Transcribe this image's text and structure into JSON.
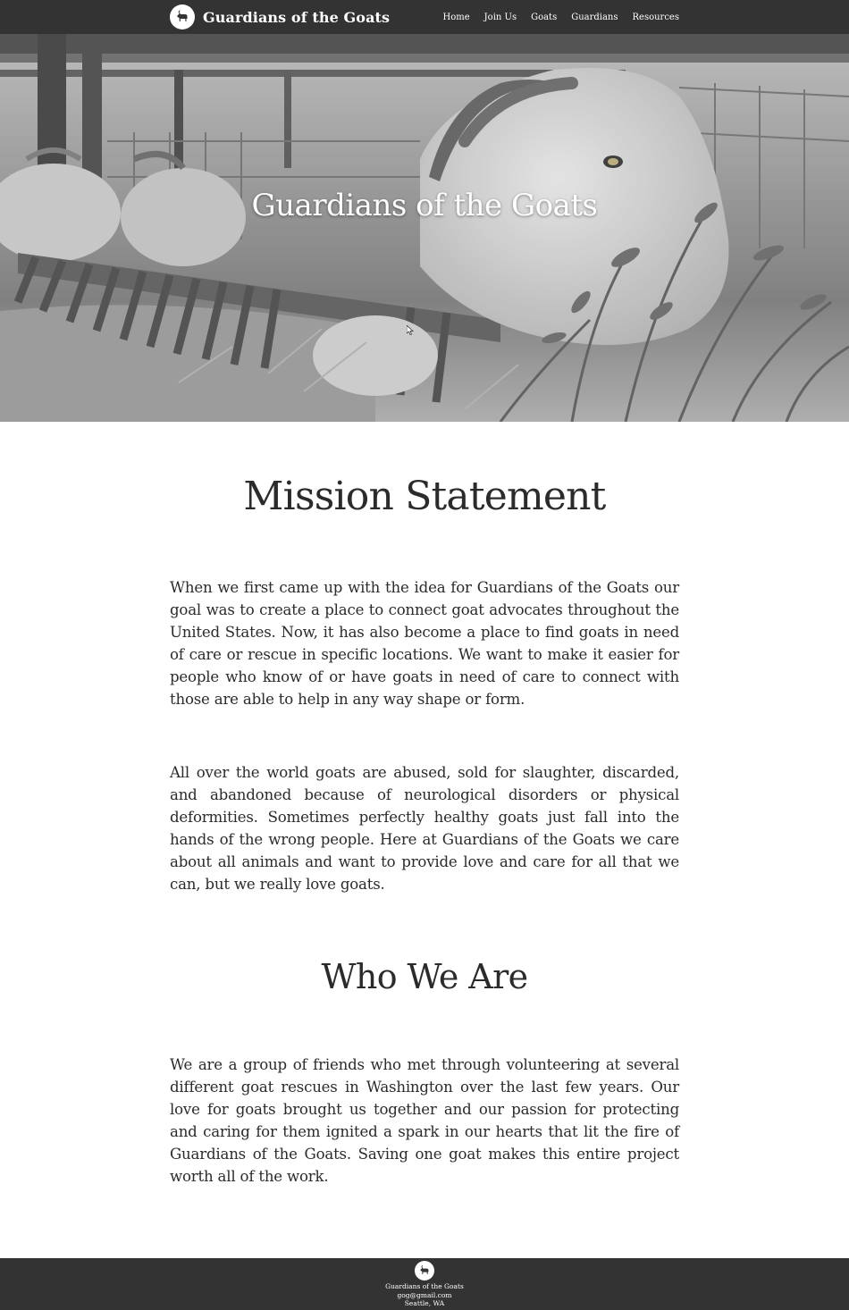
{
  "nav": {
    "brand": "Guardians of the Goats",
    "links": [
      "Home",
      "Join Us",
      "Goats",
      "Guardians",
      "Resources"
    ]
  },
  "hero": {
    "title": "Guardians of the Goats"
  },
  "mission": {
    "heading": "Mission Statement",
    "paragraphs": [
      "When we first came up with the idea for Guardians of the Goats our goal was to create a place to connect goat advocates throughout the United States. Now, it has also become a place to find goats in need of care or rescue in specific locations. We want to make it easier for people who know of or have goats in need of care to connect with those are able to help in any way shape or form.",
      "All over the world goats are abused, sold for slaughter, discarded, and abandoned because of neurological disorders or physical deformities. Sometimes perfectly healthy goats just fall into the hands of the wrong people. Here at Guardians of the Goats we care about all animals and want to provide love and care for all that we can, but we really love goats."
    ]
  },
  "who": {
    "heading": "Who We Are",
    "paragraph": "We are a group of friends who met through volunteering at several different goat rescues in Washington over the last few years. Our love for goats brought us together and our passion for protecting and caring for them ignited a spark in our hearts that lit the fire of Guardians of the Goats. Saving one goat makes this entire project worth all of the work."
  },
  "footer": {
    "name": "Guardians of the Goats",
    "email": "gog@gmail.com",
    "location": "Seattle, WA"
  },
  "colors": {
    "nav_bg": "#333333",
    "footer_bg": "#333333",
    "text": "#2b2b2b",
    "nav_text": "#ffffff"
  },
  "icons": {
    "brand_logo": "goat-logo-icon",
    "footer_logo": "goat-logo-icon",
    "cursor": "mouse-cursor-icon"
  }
}
